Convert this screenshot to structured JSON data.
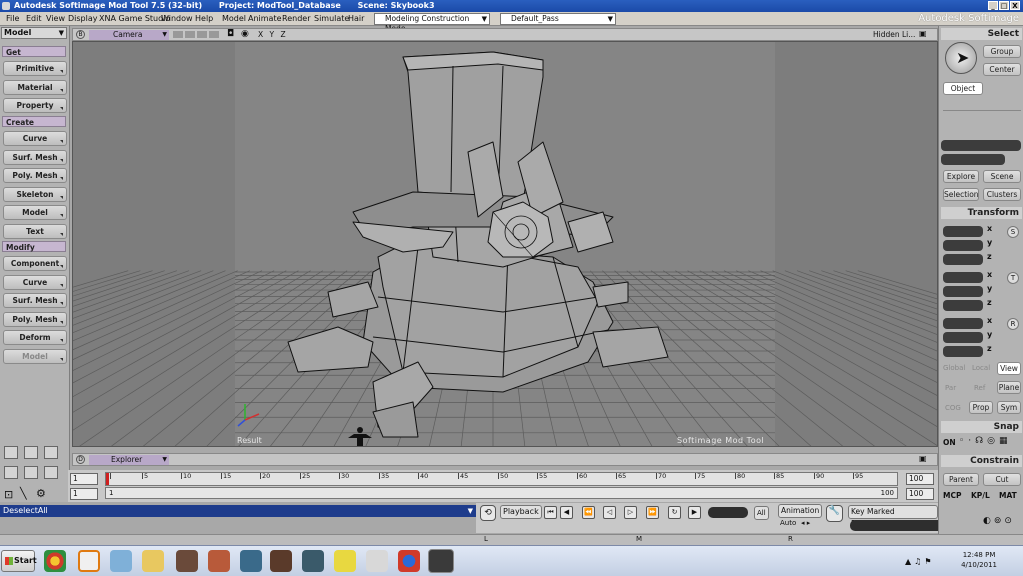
{
  "window": {
    "title_app": "Autodesk Softimage Mod Tool 7.5 (32-bit)",
    "title_project": "Project: ModTool_Database",
    "title_scene": "Scene: Skybook3",
    "brand": "Autodesk Softimage",
    "min": "_",
    "max": "□",
    "close": "X"
  },
  "menu": {
    "items": [
      "File",
      "Edit",
      "View",
      "Display",
      "XNA Game Studio",
      "Window",
      "Help",
      "Model",
      "Animate",
      "Render",
      "Simulate",
      "Hair"
    ],
    "construction_mode": "Modeling Construction Mode",
    "pass": "Default_Pass"
  },
  "left": {
    "mode": "Model",
    "sections": {
      "get": "Get",
      "create": "Create",
      "modify": "Modify"
    },
    "get_buttons": [
      "Primitive",
      "Material",
      "Property"
    ],
    "create_buttons": [
      "Curve",
      "Surf. Mesh",
      "Poly. Mesh",
      "Skeleton",
      "Model",
      "Text"
    ],
    "modify_buttons": [
      "Component",
      "Curve",
      "Surf. Mesh",
      "Poly. Mesh",
      "Deform",
      "Model"
    ]
  },
  "viewport": {
    "letter": "B",
    "camera": "Camera",
    "axes": "X Y Z",
    "hidden": "Hidden Li...",
    "result": "Result",
    "watermark": "Softimage  Mod  Tool"
  },
  "explorer": {
    "letter": "D",
    "label": "Explorer"
  },
  "timeline": {
    "start": "1",
    "start2": "1",
    "end": "100",
    "end2": "100",
    "end_right": "100",
    "ticks": [
      "1",
      "5",
      "10",
      "15",
      "20",
      "25",
      "30",
      "35",
      "40",
      "45",
      "50",
      "55",
      "60",
      "65",
      "70",
      "75",
      "80",
      "85",
      "90",
      "95"
    ],
    "sub_start": "1",
    "sub_end": "100"
  },
  "command": {
    "text": "DeselectAll"
  },
  "playback": {
    "playback_label": "Playback",
    "current": "",
    "all": "All",
    "animation": "Animation",
    "auto": "Auto",
    "key_marked": "Key Marked Parameters"
  },
  "right": {
    "select_title": "Select",
    "group": "Group",
    "center": "Center",
    "object": "Object",
    "explore": "Explore",
    "scene": "Scene",
    "selection": "Selection",
    "clusters": "Clusters",
    "transform_title": "Transform",
    "axes": [
      "x",
      "y",
      "z"
    ],
    "scale": "S",
    "rotate": "R",
    "translate": "T",
    "global": "Global",
    "local": "Local",
    "view": "View",
    "par": "Par",
    "ref": "Ref",
    "plane": "Plane",
    "cog": "COG",
    "prop": "Prop",
    "sym": "Sym",
    "snap_title": "Snap",
    "on": "ON",
    "constrain_title": "Constrain",
    "parent": "Parent",
    "cut": "Cut",
    "mcp": "MCP",
    "kpl": "KP/L",
    "mat": "MAT"
  },
  "status": {
    "l": "L",
    "m": "M",
    "r": "R"
  },
  "taskbar": {
    "start": "Start",
    "time": "12:48 PM",
    "date": "4/10/2011"
  }
}
